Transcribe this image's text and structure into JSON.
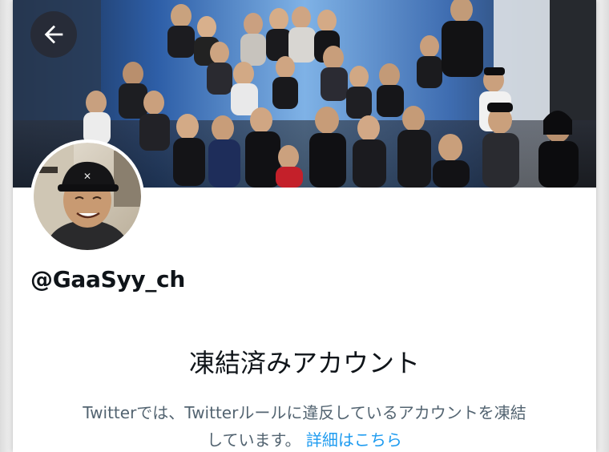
{
  "profile": {
    "handle": "@GaaSyy_ch"
  },
  "notice": {
    "title": "凍結済みアカウント",
    "body_line1": "Twitterでは、Twitterルールに違反しているアカウントを凍結",
    "body_line2": "しています。",
    "link_label": "詳細はこちら"
  },
  "icons": {
    "back": "arrow-left-icon"
  },
  "colors": {
    "link": "#1d9bf0",
    "text_primary": "#0f1419",
    "text_secondary": "#536471",
    "back_button_bg": "#28282f"
  }
}
